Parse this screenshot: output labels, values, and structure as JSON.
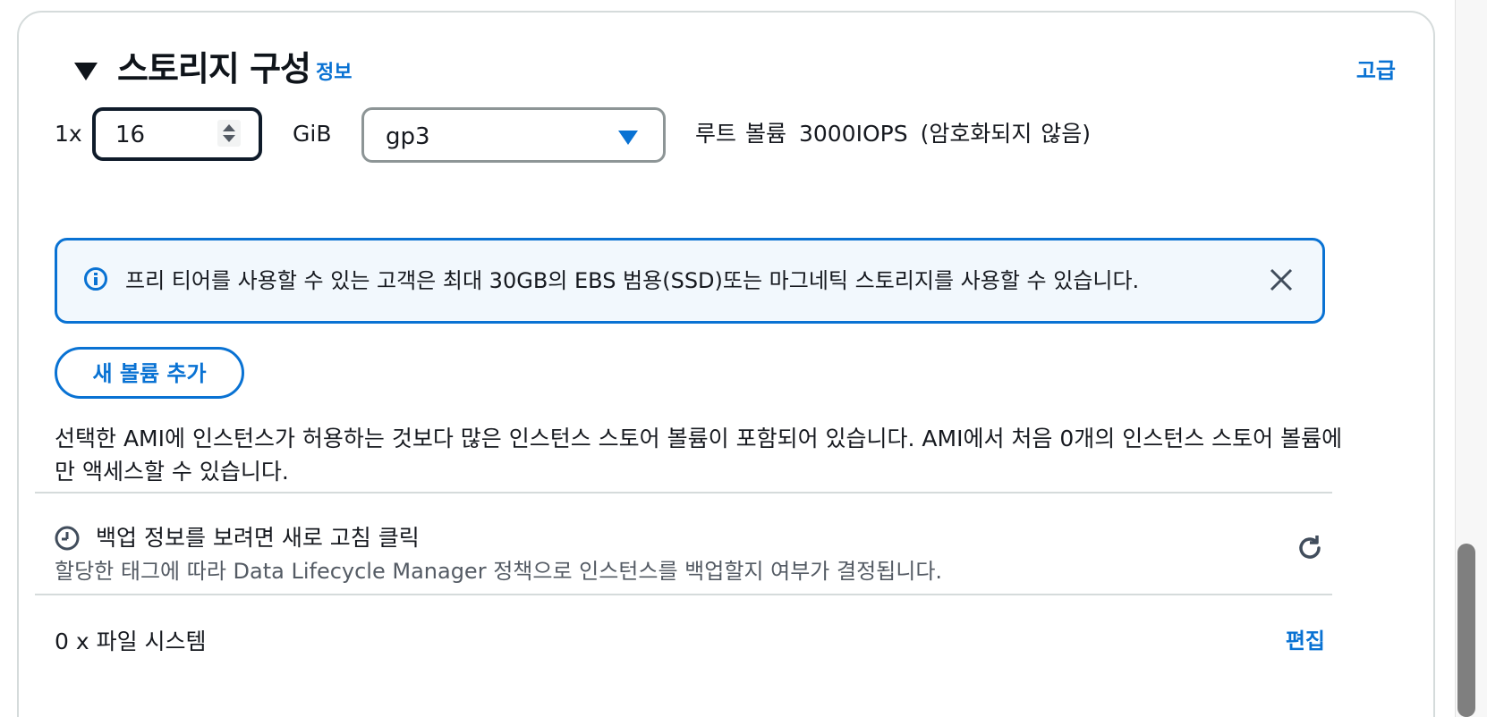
{
  "storage": {
    "title": "스토리지 구성",
    "info_link": "정보",
    "advanced_link": "고급",
    "quantity_label": "1x",
    "size_value": "16",
    "size_unit": "GiB",
    "volume_type": "gp3",
    "volume_desc": {
      "root": "루트 볼륨",
      "iops": "3000IOPS",
      "encryption": "(암호화되지 않음)"
    },
    "alert_text": "프리 티어를 사용할 수 있는 고객은 최대 30GB의 EBS 범용(SSD)또는 마그네틱 스토리지를 사용할 수 있습니다.",
    "add_volume_label": "새 볼륨 추가",
    "ami_note": "선택한 AMI에 인스턴스가 허용하는 것보다 많은 인스턴스 스토어 볼륨이 포함되어 있습니다. AMI에서 처음 0개의 인스턴스 스토어 볼륨에만 액세스할 수 있습니다.",
    "backup_title": "백업 정보를 보려면 새로 고침 클릭",
    "backup_desc": "할당한 태그에 따라 Data Lifecycle Manager 정책으로 인스턴스를 백업할지 여부가 결정됩니다.",
    "file_system_label": "0 x 파일 시스템",
    "edit_link": "편집"
  },
  "icons": {
    "caret": "caret-down-icon",
    "info": "info-icon",
    "close": "close-icon",
    "clock": "clock-icon",
    "refresh": "refresh-icon",
    "select_caret": "chevron-down-icon"
  },
  "colors": {
    "accent": "#0972d3",
    "alert_bg": "#f2f8fd",
    "border": "#d5dbdb",
    "focus_border": "#0f1b2a"
  }
}
